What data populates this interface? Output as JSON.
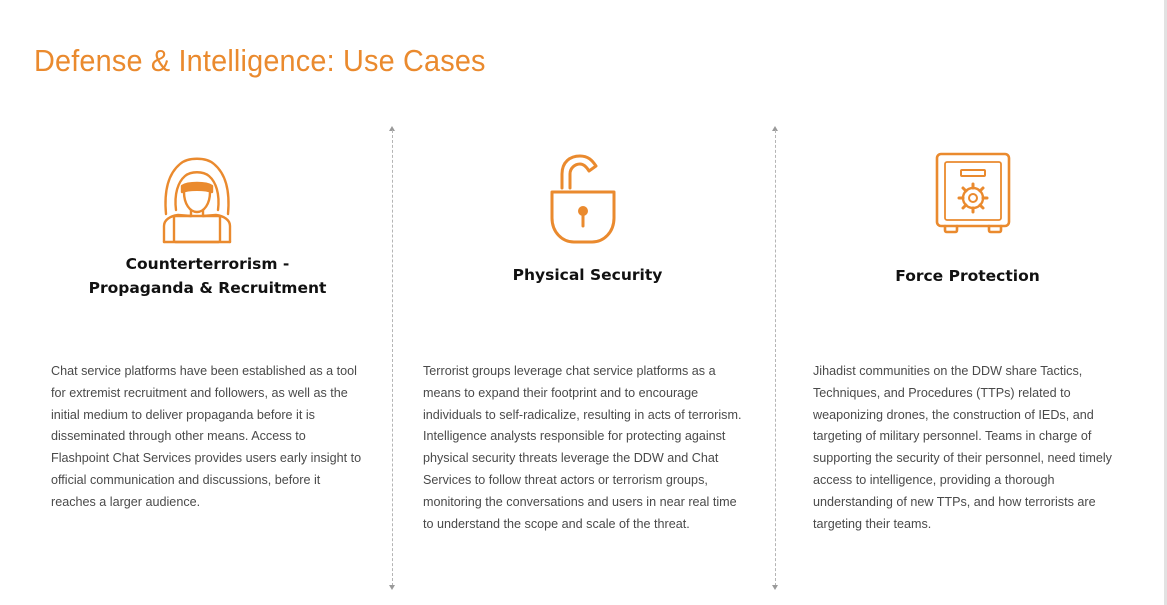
{
  "page": {
    "title": "Defense & Intelligence: Use Cases",
    "accent_color": "#ea8a2e"
  },
  "cards": [
    {
      "icon": "hooded-hacker-icon",
      "title": "Counterterrorism -\nPropaganda & Recruitment",
      "body": " Chat service platforms have been established as a tool\nfor extremist recruitment and followers, as well as the\ninitial medium to deliver propaganda before it is\ndisseminated through other means. Access to\nFlashpoint Chat Services provides users early insight to\nofficial communication and discussions, before it\nreaches a larger audience."
    },
    {
      "icon": "open-padlock-icon",
      "title": "Physical Security",
      "body": "Terrorist groups leverage chat service platforms as a\nmeans to expand their footprint and to encourage\nindividuals to self-radicalize, resulting in acts of terrorism.\nIntelligence analysts responsible for protecting against\nphysical security threats leverage the DDW and Chat\nServices to follow threat actors or terrorism groups,\nmonitoring the conversations and users in near real time\nto understand the scope and scale of the threat."
    },
    {
      "icon": "safe-vault-icon",
      "title": "Force Protection",
      "body": " Jihadist communities on the DDW share Tactics,\nTechniques, and Procedures (TTPs) related to\nweaponizing drones, the construction of IEDs, and\ntargeting of military personnel. Teams in charge of\nsupporting the security of their personnel, need timely\naccess to intelligence, providing a thorough\nunderstanding of new TTPs, and how terrorists are\ntargeting their teams."
    }
  ]
}
